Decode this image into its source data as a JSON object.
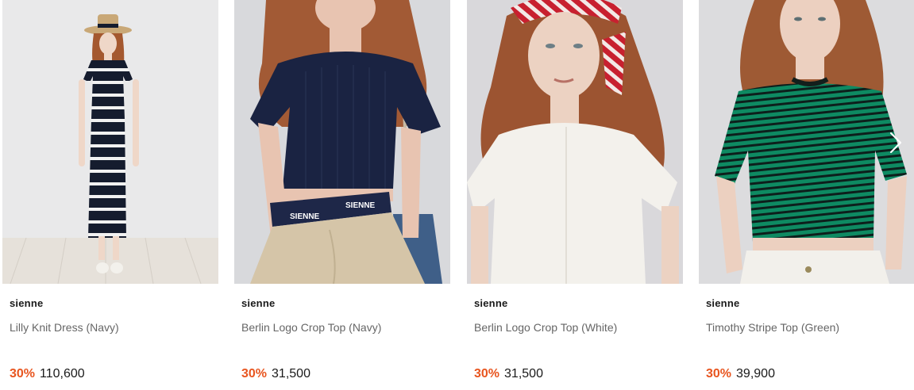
{
  "products": [
    {
      "brand": "sienne",
      "name": "Lilly Knit Dress (Navy)",
      "discount": "30%",
      "price": "110,600"
    },
    {
      "brand": "sienne",
      "name": "Berlin Logo Crop Top (Navy)",
      "discount": "30%",
      "price": "31,500"
    },
    {
      "brand": "sienne",
      "name": "Berlin Logo Crop Top (White)",
      "discount": "30%",
      "price": "31,500"
    },
    {
      "brand": "sienne",
      "name": "Timothy Stripe Top (Green)",
      "discount": "30%",
      "price": "39,900"
    }
  ],
  "waistband_text": "SIENNE",
  "colors": {
    "discount": "#e8551f",
    "brand": "#1a1a1a",
    "product_name": "#666666"
  },
  "icons": {
    "next": "chevron-right-icon"
  }
}
